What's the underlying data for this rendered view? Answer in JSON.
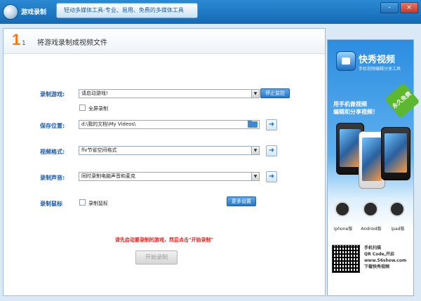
{
  "window": {
    "title": "游戏录制",
    "slogan": "轻动多媒体工具-专业、易用、免费的多媒体工具",
    "controls": [
      "-",
      "×"
    ]
  },
  "step": {
    "number": "1",
    "total": "1",
    "title": "将游戏录制成视频文件"
  },
  "form": {
    "game_label": "录制游戏:",
    "game_value": "请启动游戏!",
    "stop_button": "停止监控",
    "fullscreen_label": "全屏录制",
    "save_label": "保存位置:",
    "save_value": "d:\\我的文档\\My Videos\\",
    "format_label": "视频格式:",
    "format_value": "flv节省空间格式",
    "audio_label": "录制声音:",
    "audio_value": "同时录制电脑声音和麦克",
    "mouse_label": "录制鼠标",
    "mouse_checkbox_label": "录制鼠标",
    "more_settings_button": "更多设置",
    "hint": "请先启动要录制的游戏，然后点击\"开始录制\"",
    "start_button": "开始录制"
  },
  "promo": {
    "brand": "快秀视频",
    "subtitle": "手机视频编辑分享工具",
    "tagline_1": "用手机做视频",
    "tagline_2": "编辑和分享视频！",
    "ribbon": "永久免费",
    "os": [
      {
        "label": "iphone版",
        "icon": "apple-icon"
      },
      {
        "label": "Android版",
        "icon": "android-icon"
      },
      {
        "label": "ipad版",
        "icon": "ipad-icon"
      }
    ],
    "qr_line_1": "手机扫描",
    "qr_line_2": "QR Code,开启",
    "qr_line_3": "www.56show.com",
    "qr_line_4": "下载快秀视频"
  }
}
